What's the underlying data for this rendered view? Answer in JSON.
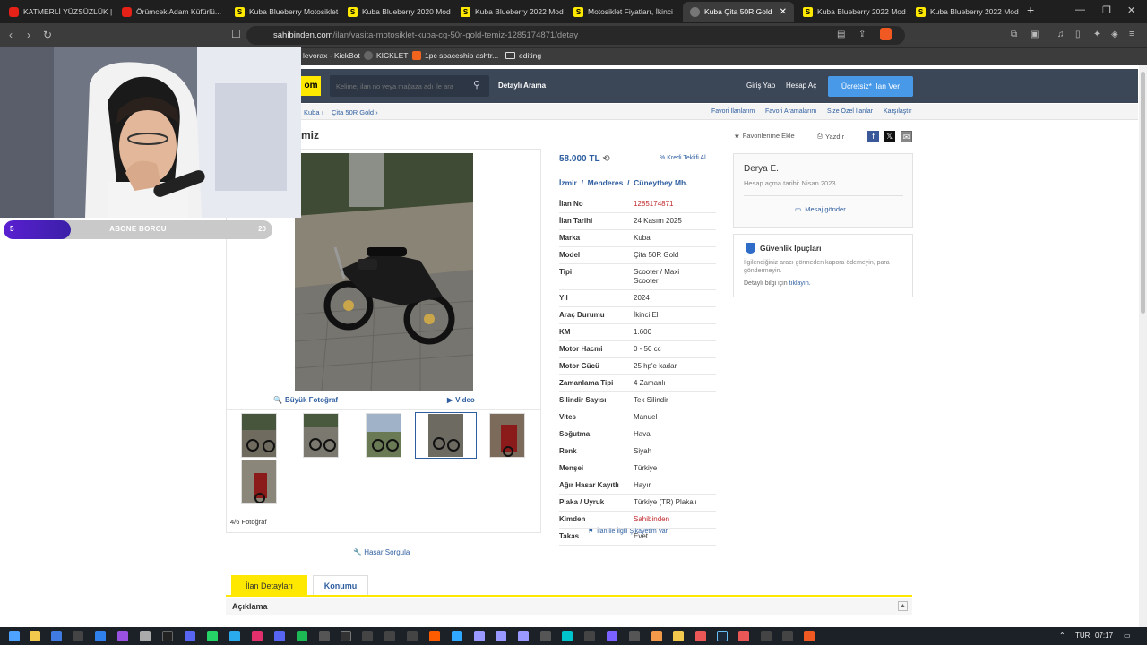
{
  "browser": {
    "tabs": [
      {
        "label": "KATMERLİ YÜZSÜZLÜK | S",
        "icon": "youtube-icon"
      },
      {
        "label": "Örümcek Adam Küfürlü...",
        "icon": "youtube-icon"
      },
      {
        "label": "Kuba Blueberry Motosiklet",
        "icon": "sahibinden-icon"
      },
      {
        "label": "Kuba Blueberry 2020 Mod",
        "icon": "sahibinden-icon"
      },
      {
        "label": "Kuba Blueberry 2022 Mod",
        "icon": "sahibinden-icon"
      },
      {
        "label": "Motosiklet Fiyatları, İkinci",
        "icon": "sahibinden-icon"
      },
      {
        "label": "Kuba Çita 50R Gold",
        "icon": "globe-icon",
        "active": true
      },
      {
        "label": "Kuba Blueberry 2022 Mod",
        "icon": "sahibinden-icon"
      },
      {
        "label": "Kuba Blueberry 2022 Mod",
        "icon": "sahibinden-icon"
      }
    ],
    "url_host": "sahibinden.com",
    "url_path": "/ilan/vasita-motosiklet-kuba-cg-50r-gold-temiz-1285174871/detay",
    "bookmarks": [
      "levorax - KickBot",
      "KICKLET",
      "1pc spaceship ashtr...",
      "editing"
    ]
  },
  "site": {
    "logo": "om",
    "search_placeholder": "Kelime, ilan no veya mağaza adı ile ara",
    "detailed_search": "Detaylı Arama",
    "login": "Giriş Yap",
    "signup": "Hesap Aç",
    "post_ad": "Ücretsiz* İlan Ver",
    "breadcrumb": [
      "Kuba",
      "Çita 50R Gold"
    ],
    "crumb_links": [
      "Favori İlanlarım",
      "Favori Aramalarım",
      "Size Özel İlanlar",
      "Karşılaştır"
    ]
  },
  "listing": {
    "title_fragment": "miz",
    "add_favorites": "Favorilerime Ekle",
    "print": "Yazdır",
    "big_photo": "Büyük Fotoğraf",
    "video": "Video",
    "photo_count": "4/6 Fotoğraf",
    "price": "58.000 TL",
    "credit_offer": "Kredi Teklifi Al",
    "location": [
      "İzmir",
      "Menderes",
      "Cüneytbey Mh."
    ],
    "details": [
      {
        "label": "İlan No",
        "value": "1285174871",
        "red": true
      },
      {
        "label": "İlan Tarihi",
        "value": "24 Kasım 2025"
      },
      {
        "label": "Marka",
        "value": "Kuba"
      },
      {
        "label": "Model",
        "value": "Çita 50R Gold"
      },
      {
        "label": "Tipi",
        "value": "Scooter / Maxi Scooter"
      },
      {
        "label": "Yıl",
        "value": "2024"
      },
      {
        "label": "Araç Durumu",
        "value": "İkinci El"
      },
      {
        "label": "KM",
        "value": "1.600"
      },
      {
        "label": "Motor Hacmi",
        "value": "0 - 50 cc"
      },
      {
        "label": "Motor Gücü",
        "value": "25 hp'e kadar"
      },
      {
        "label": "Zamanlama Tipi",
        "value": "4 Zamanlı"
      },
      {
        "label": "Silindir Sayısı",
        "value": "Tek Silindir"
      },
      {
        "label": "Vites",
        "value": "Manuel"
      },
      {
        "label": "Soğutma",
        "value": "Hava"
      },
      {
        "label": "Renk",
        "value": "Siyah"
      },
      {
        "label": "Menşei",
        "value": "Türkiye"
      },
      {
        "label": "Ağır Hasar Kayıtlı",
        "value": "Hayır"
      },
      {
        "label": "Plaka / Uyruk",
        "value": "Türkiye (TR) Plakalı"
      },
      {
        "label": "Kimden",
        "value": "Sahibinden",
        "red": true
      },
      {
        "label": "Takas",
        "value": "Evet"
      }
    ],
    "complaint": "İlan ile İlgili Şikayetim Var",
    "damage_query": "Hasar Sorgula",
    "tabs": [
      "İlan Detayları",
      "Konumu"
    ],
    "description_heading": "Açıklama"
  },
  "seller": {
    "name": "Derya E.",
    "joined": "Hesap açma tarihi: Nisan 2023",
    "message": "Mesaj gönder"
  },
  "safety": {
    "title": "Güvenlik İpuçları",
    "text": "İlgilendiğiniz aracı görmeden kapora ödemeyin, para göndermeyin.",
    "more_prefix": "Detaylı bilgi için",
    "more_link": "tıklayın."
  },
  "overlay": {
    "abone_left": "5",
    "abone_label": "ABONE BORCU",
    "abone_right": "20",
    "abone_progress": 0.25
  },
  "taskbar": {
    "lang": "TUR",
    "time": "07:17"
  },
  "colors": {
    "accent_blue": "#2e5ea0",
    "brand_yellow": "#ffe800",
    "header_bg": "#3b4657",
    "price_red": "#c0282d"
  }
}
